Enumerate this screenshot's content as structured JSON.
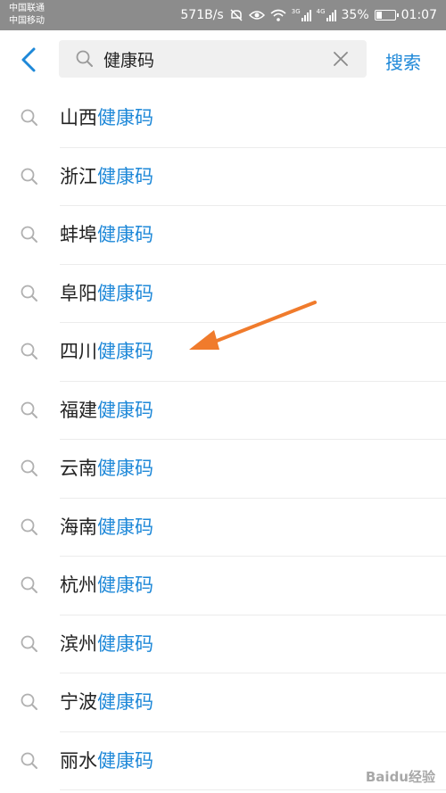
{
  "status_bar": {
    "carrier_1": "中国联通",
    "carrier_2": "中国移动",
    "speed": "571B/s",
    "signal_1_tag": "3G",
    "signal_2_tag": "4G",
    "battery": "35%",
    "battery_level": 0.35,
    "time": "01:07"
  },
  "header": {
    "query": "健康码",
    "search_label": "搜索"
  },
  "suggestions": [
    {
      "prefix": "山西",
      "keyword": "健康码"
    },
    {
      "prefix": "浙江",
      "keyword": "健康码"
    },
    {
      "prefix": "蚌埠",
      "keyword": "健康码"
    },
    {
      "prefix": "阜阳",
      "keyword": "健康码"
    },
    {
      "prefix": "四川",
      "keyword": "健康码"
    },
    {
      "prefix": "福建",
      "keyword": "健康码"
    },
    {
      "prefix": "云南",
      "keyword": "健康码"
    },
    {
      "prefix": "海南",
      "keyword": "健康码"
    },
    {
      "prefix": "杭州",
      "keyword": "健康码"
    },
    {
      "prefix": "滨州",
      "keyword": "健康码"
    },
    {
      "prefix": "宁波",
      "keyword": "健康码"
    },
    {
      "prefix": "丽水",
      "keyword": "健康码"
    }
  ],
  "watermark": "Baidu经验",
  "colors": {
    "accent": "#1e88d8",
    "annotation_arrow": "#f07b2c",
    "status_bar_bg": "#8c8c8c"
  }
}
